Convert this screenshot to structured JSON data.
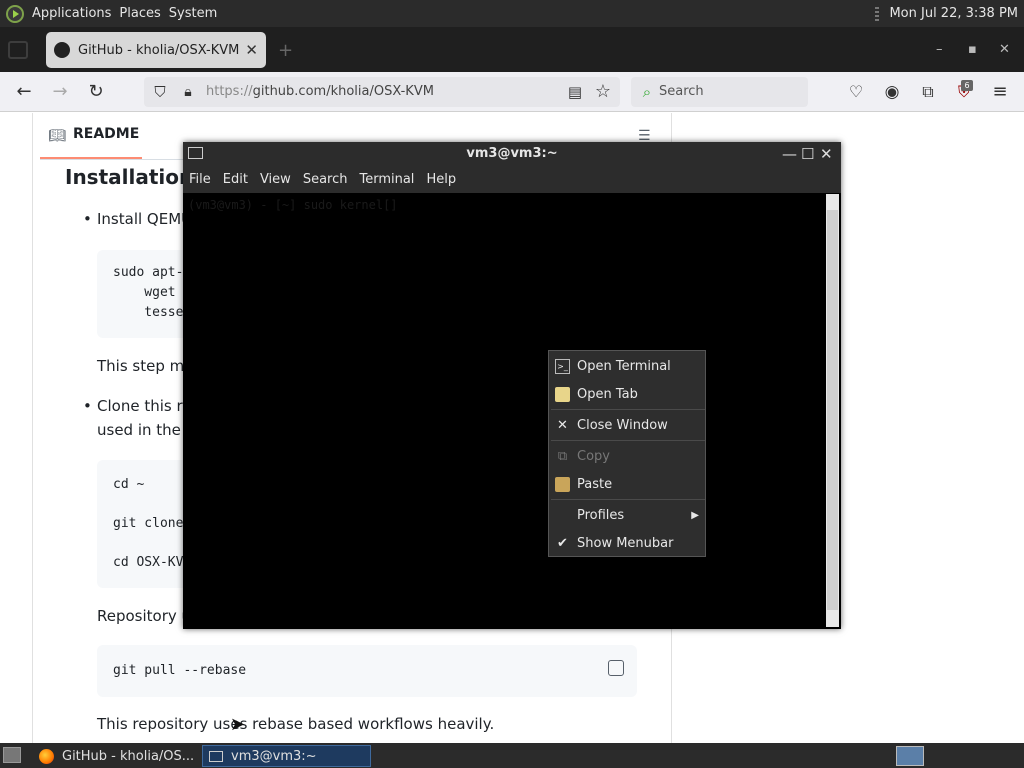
{
  "top_panel": {
    "menus": [
      "Applications",
      "Places",
      "System"
    ],
    "clock": "Mon Jul 22,  3:38 PM"
  },
  "browser": {
    "tab_title": "GitHub - kholia/OSX-KVM: R",
    "url_prefix": "https://",
    "url_main": "github.com/kholia/OSX-KVM",
    "search_placeholder": "Search",
    "extension_badge": "6",
    "win_controls": {
      "minimize": "–",
      "maximize": "▪",
      "close": "✕"
    }
  },
  "github": {
    "readme_tab": "README",
    "heading": "Installation P",
    "bullet1": "Install QEMU",
    "code1": [
      "sudo apt-",
      "    wget",
      "    tesse"
    ],
    "para1": "This step ma",
    "bullet2_line1": "Clone this re",
    "bullet2_line2": "used in the f",
    "code2": [
      "cd ~",
      "",
      "git clone",
      "",
      "cd OSX-KV"
    ],
    "para2": "Repository u",
    "code3": "git pull --rebase",
    "para3": "This repository uses rebase based workflows heavily."
  },
  "terminal": {
    "title": "vm3@vm3:~",
    "menus": [
      "File",
      "Edit",
      "View",
      "Search",
      "Terminal",
      "Help"
    ],
    "prompt": "(vm3@vm3) - [~] sudo kernel[]"
  },
  "context_menu": {
    "items": [
      {
        "label": "Open Terminal",
        "icon": "terminal-icon",
        "enabled": true
      },
      {
        "label": "Open Tab",
        "icon": "folder-tab-icon",
        "enabled": true
      },
      {
        "label": "Close Window",
        "icon": "close-icon",
        "enabled": true
      },
      {
        "label": "Copy",
        "icon": "copy-icon",
        "enabled": false
      },
      {
        "label": "Paste",
        "icon": "paste-icon",
        "enabled": true
      },
      {
        "label": "Profiles",
        "icon": "",
        "enabled": true,
        "submenu": true
      },
      {
        "label": "Show Menubar",
        "icon": "check-icon",
        "enabled": true,
        "checked": true
      }
    ]
  },
  "taskbar": {
    "items": [
      {
        "label": "GitHub - kholia/OS...",
        "icon": "firefox-icon"
      },
      {
        "label": "vm3@vm3:~",
        "icon": "terminal-icon",
        "active": true
      }
    ]
  }
}
